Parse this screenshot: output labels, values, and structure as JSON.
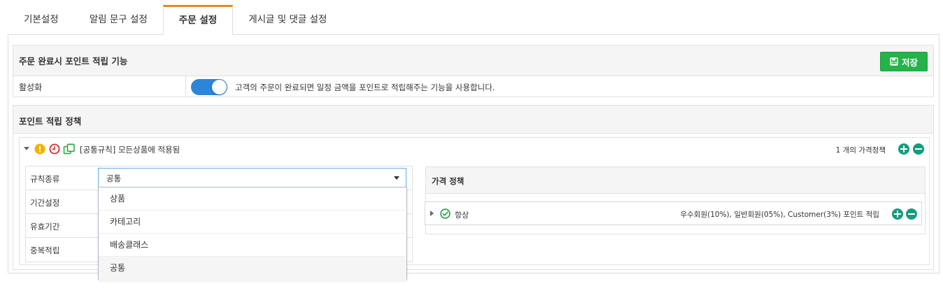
{
  "tabs": [
    {
      "label": "기본설정",
      "active": false
    },
    {
      "label": "알림 문구 설정",
      "active": false
    },
    {
      "label": "주문 설정",
      "active": true
    },
    {
      "label": "게시글 및 댓글 설정",
      "active": false
    }
  ],
  "point_feature": {
    "title": "주문 완료시 포인트 적립 기능",
    "save_label": "저장",
    "activation_label": "활성화",
    "activation_on": true,
    "activation_desc": "고객의 주문이 완료되면 일정 금액을 포인트로 적립해주는 기능을 사용합니다."
  },
  "policy": {
    "title": "포인트 적립 정책",
    "rule": {
      "title": "[공통규칙] 모든상품에 적용됨",
      "count_text": "1 개의 가격정책",
      "fields": [
        "규칙종류",
        "기간설정",
        "유효기간",
        "중복적립"
      ],
      "select_value": "공통",
      "options": [
        "상품",
        "카테고리",
        "배송클래스",
        "공통"
      ]
    },
    "price_policy": {
      "title": "가격 정책",
      "item_name": "항상",
      "item_desc": "우수회원(10%), 일반회원(05%), Customer(3%) 포인트 적립"
    }
  },
  "colors": {
    "tab_active_border": "#e08a26",
    "save_button": "#23b34a",
    "toggle_on": "#2b86d9",
    "circle_button": "#149c7c",
    "warn_icon": "#f0b400",
    "clock_icon": "#d9302c",
    "copy_icon": "#26a33b",
    "check_icon": "#2aa34a"
  },
  "icons": {
    "save": "save-icon",
    "warning": "warning-icon",
    "clock": "clock-icon",
    "copy": "copy-icon",
    "check": "check-circle-icon",
    "plus": "plus-circle-icon",
    "minus": "minus-circle-icon"
  }
}
